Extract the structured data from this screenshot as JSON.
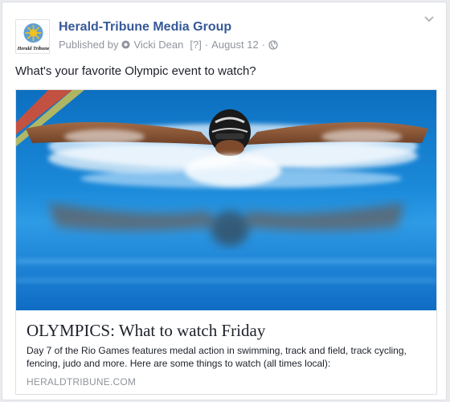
{
  "post": {
    "page_name": "Herald-Tribune Media Group",
    "logo_text": "Herald Tribune",
    "published_by_label": "Published by",
    "author": "Vicki Dean",
    "help_mark": "[?]",
    "separator": "·",
    "date": "August 12",
    "caption": "What's your favorite Olympic event to watch?"
  },
  "link_preview": {
    "image": "swimmer-butterfly-photo",
    "headline": "OLYMPICS: What to watch Friday",
    "description": "Day 7 of the Rio Games features medal action in swimming, track and field, track cycling, fencing, judo and more. Here are some things to watch (all times local):",
    "domain": "HERALDTRIBUNE.COM"
  },
  "icons": {
    "menu": "chevron-down-icon",
    "publisher": "gear-icon",
    "audience": "globe-icon"
  },
  "colors": {
    "page_name": "#365899",
    "meta": "#90949c",
    "text": "#1d2129",
    "pool_blue": "#1e88d8"
  }
}
